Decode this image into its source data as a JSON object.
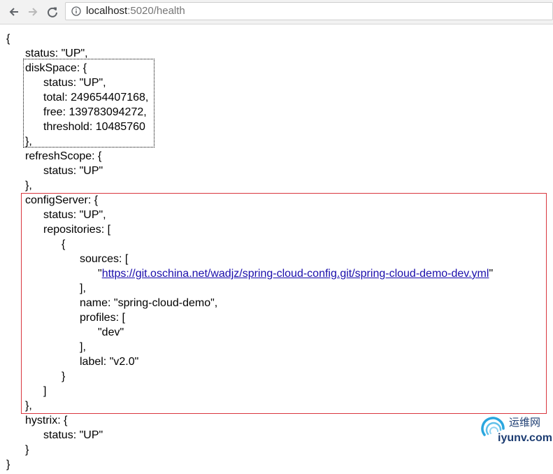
{
  "browser": {
    "url_host": "localhost",
    "url_path": ":5020/health"
  },
  "json_lines": [
    "{",
    "status: \"UP\",",
    "diskSpace: {",
    "status: \"UP\",",
    "total: 249654407168,",
    "free: 139783094272,",
    "threshold: 10485760",
    "},",
    "refreshScope: {",
    "status: \"UP\"",
    "},",
    "configServer: {",
    "status: \"UP\",",
    "repositories: [",
    "{",
    "sources: [",
    "\"",
    "https://git.oschina.net/wadjz/spring-cloud-config.git/spring-cloud-demo-dev.yml",
    "\"",
    "],",
    "name: \"spring-cloud-demo\",",
    "profiles: [",
    "\"dev\"",
    "],",
    "label: \"v2.0\"",
    "}",
    "]",
    "},",
    "hystrix: {",
    "status: \"UP\"",
    "}",
    "}"
  ],
  "watermark": {
    "chinese": "运维网",
    "domain": "iyunv.com"
  },
  "colors": {
    "link": "#1a0dab",
    "highlight_box": "#d9363e"
  },
  "icons": [
    "back-arrow-icon",
    "forward-arrow-icon",
    "reload-icon",
    "info-icon"
  ]
}
